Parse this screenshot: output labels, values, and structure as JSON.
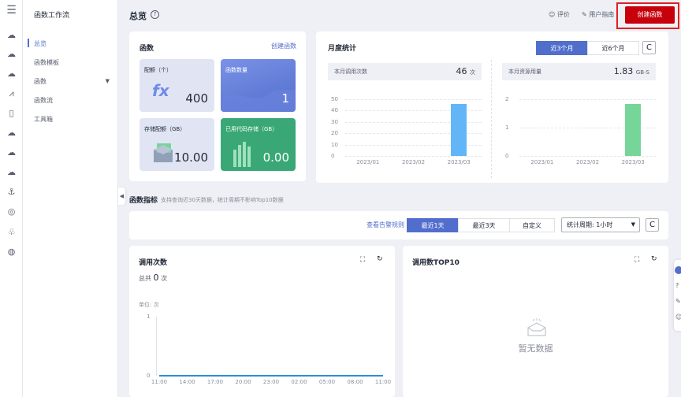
{
  "rail_icons": [
    "menu-icon",
    "cloud-icon",
    "cloud-icon",
    "cloud-icon",
    "cloud-icon",
    "cloud-icon",
    "cloud-icon",
    "cloud-icon",
    "cloud-icon",
    "anchor-icon",
    "cloud-icon",
    "cloud-icon",
    "globe-icon"
  ],
  "nav": {
    "service_title": "函数工作流",
    "items": [
      {
        "label": "总览",
        "active": true
      },
      {
        "label": "函数模板"
      },
      {
        "label": "函数",
        "has_caret": true
      },
      {
        "label": "函数流"
      },
      {
        "label": "工具箱"
      }
    ]
  },
  "header": {
    "title": "总览",
    "help": "?",
    "rate": "评价",
    "guide": "用户指南",
    "create": "创建函数"
  },
  "function_card": {
    "title": "函数",
    "create_link": "创建函数",
    "tiles": [
      {
        "label": "配额（个）",
        "value": "400"
      },
      {
        "label": "函数数量",
        "value": "1"
      },
      {
        "label": "存储配额（GB）",
        "value": "10.00"
      },
      {
        "label": "已用代码存储（GB）",
        "value": "0.00"
      }
    ]
  },
  "monthly": {
    "title": "月度统计",
    "tabs": [
      "近3个月",
      "近6个月"
    ],
    "refresh": "C",
    "left": {
      "label": "本月调用次数",
      "value": "46",
      "unit": "次",
      "yticks": [
        "50",
        "40",
        "30",
        "20",
        "10",
        "0"
      ]
    },
    "right": {
      "label": "本月资源用量",
      "value": "1.83",
      "unit": "GB-S",
      "yticks": [
        "2",
        "1",
        "0"
      ]
    },
    "months": [
      "2023/01",
      "2023/02",
      "2023/03"
    ]
  },
  "chart_data": [
    {
      "type": "bar",
      "categories": [
        "2023/01",
        "2023/02",
        "2023/03"
      ],
      "values": [
        0,
        0,
        46
      ],
      "ylim": [
        0,
        50
      ],
      "title": "本月调用次数"
    },
    {
      "type": "bar",
      "categories": [
        "2023/01",
        "2023/02",
        "2023/03"
      ],
      "values": [
        0,
        0,
        1.83
      ],
      "ylim": [
        0,
        2
      ],
      "title": "本月资源用量"
    },
    {
      "type": "line",
      "categories": [
        "11:00",
        "14:00",
        "17:00",
        "20:00",
        "23:00",
        "02:00",
        "05:00",
        "08:00",
        "11:00"
      ],
      "values": [
        0,
        0,
        0,
        0,
        0,
        0,
        0,
        0,
        0
      ],
      "ylim": [
        0,
        1
      ],
      "title": "调用次数",
      "ylabel": "单位: 次"
    }
  ],
  "metrics": {
    "title": "函数指标",
    "hint": "支持查询近30天数据，统计周期不影响Top10数据",
    "alarm_link": "查看告警规则",
    "ranges": [
      "最近1天",
      "最近3天",
      "自定义"
    ],
    "period_label": "统计周期:",
    "period_value": "1小时",
    "refresh": "C"
  },
  "invocations": {
    "title": "调用次数",
    "total_label": "总共",
    "total_value": "0",
    "total_unit": "次",
    "unit_label": "单位: 次",
    "yticks": [
      "1",
      "0"
    ],
    "xticks": [
      "11:00",
      "14:00",
      "17:00",
      "20:00",
      "23:00",
      "02:00",
      "05:00",
      "08:00",
      "11:00"
    ]
  },
  "top10": {
    "title": "调用数TOP10",
    "empty": "暂无数据"
  },
  "colors": {
    "accent": "#526ecc",
    "danger": "#c7000b",
    "bar_blue": "#62b6f7",
    "bar_green": "#76d69a",
    "line": "#2a8fd8"
  }
}
